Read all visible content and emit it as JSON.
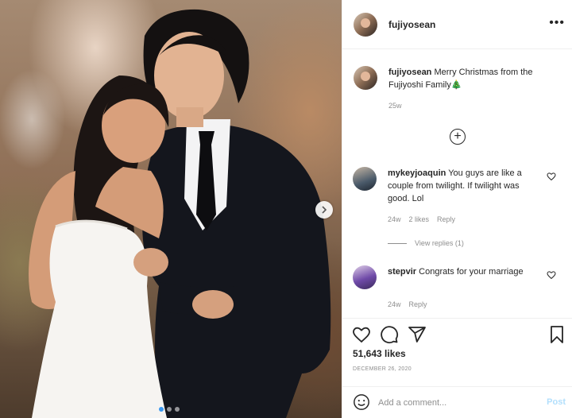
{
  "post": {
    "author": "fujiyosean",
    "more_icon": "more-horizontal-icon",
    "caption_author": "fujiyosean",
    "caption_text": "Merry Christmas from the Fujiyoshi Family🎄",
    "caption_age": "25w",
    "load_more_icon": "plus-circle-icon",
    "photo_carousel": {
      "next_icon": "chevron-right-icon",
      "dots": 3,
      "active_dot": 1
    }
  },
  "comments": [
    {
      "username": "mykeyjoaquin",
      "text": "You guys are like a couple from twilight. If twilight was good. Lol",
      "age": "24w",
      "likes": "2 likes",
      "reply": "Reply",
      "view_replies": "View replies (1)",
      "avatar_color": "#4a5a6a"
    },
    {
      "username": "stepvir",
      "text": "Congrats for your marriage",
      "age": "24w",
      "reply": "Reply",
      "avatar_color": "#6f4aa8"
    }
  ],
  "actions": {
    "like_icon": "heart-icon",
    "comment_icon": "comment-icon",
    "share_icon": "paper-plane-icon",
    "save_icon": "bookmark-icon"
  },
  "likes": "51,643 likes",
  "date": "DECEMBER 26, 2020",
  "comment_box": {
    "emoji_icon": "smiley-icon",
    "placeholder": "Add a comment...",
    "post_label": "Post"
  },
  "colors": {
    "post_disabled": "#b2dffc",
    "muted": "#8e8e8e",
    "text": "#262626",
    "border": "#efefef",
    "carousel_active": "#3897f0"
  }
}
